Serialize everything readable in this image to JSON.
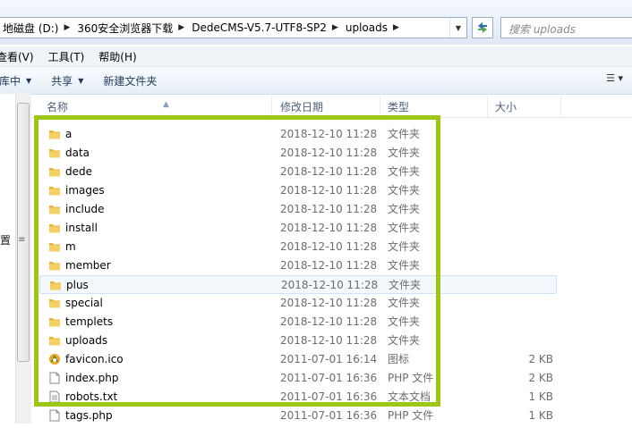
{
  "address": {
    "crumbs": [
      "地磁盘 (D:)",
      "360安全浏览器下载",
      "DedeCMS-V5.7-UTF8-SP2",
      "uploads"
    ],
    "search_placeholder": "搜索 uploads"
  },
  "menu": [
    "查看(V)",
    "工具(T)",
    "帮助(H)"
  ],
  "toolbar": {
    "library": "库中",
    "share": "共享",
    "new_folder": "新建文件夹"
  },
  "nav": {
    "partial_label": "置"
  },
  "columns": {
    "name": "名称",
    "date": "修改日期",
    "type": "类型",
    "size": "大小"
  },
  "files": [
    {
      "name": "a",
      "date": "2018-12-10 11:28",
      "type": "文件夹",
      "size": "",
      "icon": "folder-icon"
    },
    {
      "name": "data",
      "date": "2018-12-10 11:28",
      "type": "文件夹",
      "size": "",
      "icon": "folder-icon"
    },
    {
      "name": "dede",
      "date": "2018-12-10 11:28",
      "type": "文件夹",
      "size": "",
      "icon": "folder-icon"
    },
    {
      "name": "images",
      "date": "2018-12-10 11:28",
      "type": "文件夹",
      "size": "",
      "icon": "folder-icon"
    },
    {
      "name": "include",
      "date": "2018-12-10 11:28",
      "type": "文件夹",
      "size": "",
      "icon": "folder-icon"
    },
    {
      "name": "install",
      "date": "2018-12-10 11:28",
      "type": "文件夹",
      "size": "",
      "icon": "folder-icon"
    },
    {
      "name": "m",
      "date": "2018-12-10 11:28",
      "type": "文件夹",
      "size": "",
      "icon": "folder-icon"
    },
    {
      "name": "member",
      "date": "2018-12-10 11:28",
      "type": "文件夹",
      "size": "",
      "icon": "folder-icon"
    },
    {
      "name": "plus",
      "date": "2018-12-10 11:28",
      "type": "文件夹",
      "size": "",
      "icon": "folder-icon",
      "highlight": true
    },
    {
      "name": "special",
      "date": "2018-12-10 11:28",
      "type": "文件夹",
      "size": "",
      "icon": "folder-icon"
    },
    {
      "name": "templets",
      "date": "2018-12-10 11:28",
      "type": "文件夹",
      "size": "",
      "icon": "folder-icon"
    },
    {
      "name": "uploads",
      "date": "2018-12-10 11:28",
      "type": "文件夹",
      "size": "",
      "icon": "folder-icon"
    },
    {
      "name": "favicon.ico",
      "date": "2011-07-01 16:14",
      "type": "图标",
      "size": "2 KB",
      "icon": "ico-file-icon"
    },
    {
      "name": "index.php",
      "date": "2011-07-01 16:36",
      "type": "PHP 文件",
      "size": "2 KB",
      "icon": "php-file-icon"
    },
    {
      "name": "robots.txt",
      "date": "2011-07-01 16:36",
      "type": "文本文档",
      "size": "1 KB",
      "icon": "text-file-icon"
    },
    {
      "name": "tags.php",
      "date": "2011-07-01 16:36",
      "type": "PHP 文件",
      "size": "1 KB",
      "icon": "php-file-icon"
    }
  ],
  "colors": {
    "highlight_box": "#9cc813",
    "folder": "#f3c64a"
  }
}
